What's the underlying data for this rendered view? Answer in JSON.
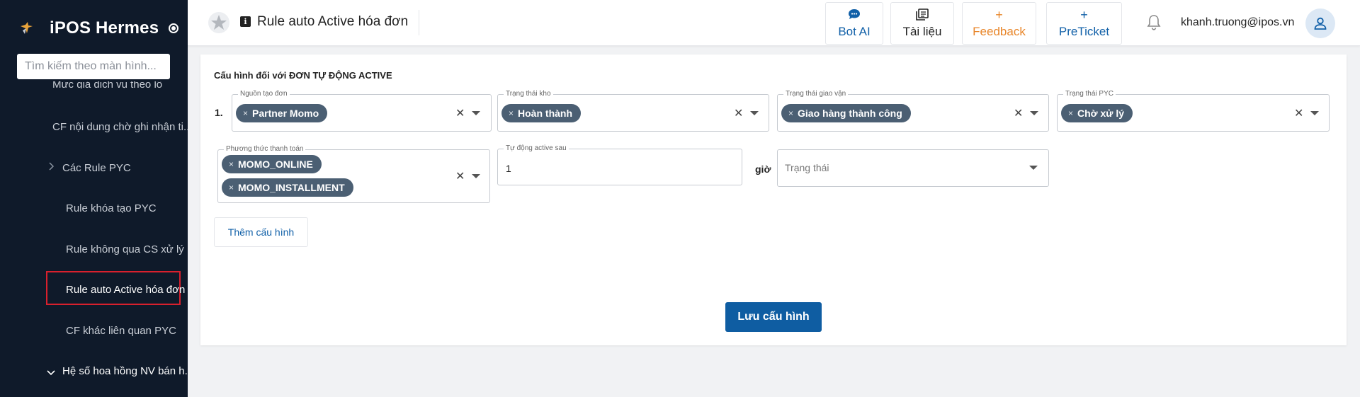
{
  "sidebar": {
    "brand": "iPOS Hermes",
    "search_placeholder": "Tìm kiếm theo màn hình...",
    "items": [
      {
        "label": "CF nội dung chờ ghi nhận ti..."
      },
      {
        "label": "Các Rule PYC"
      },
      {
        "label": "Rule khóa tạo PYC"
      },
      {
        "label": "Rule không qua CS xử lý"
      },
      {
        "label": "Rule auto Active hóa đơn"
      },
      {
        "label": "CF khác liên quan PYC"
      },
      {
        "label": "Hệ số hoa hồng NV bán h..."
      }
    ],
    "partial_item": "Mức giá dịch vụ theo lô"
  },
  "header": {
    "title": "Rule auto Active hóa đơn",
    "buttons": {
      "bot_ai": "Bot AI",
      "tai_lieu": "Tài liệu",
      "feedback": "Feedback",
      "preticket": "PreTicket"
    },
    "user_email": "khanh.truong@ipos.vn"
  },
  "config": {
    "section_title": "Cấu hình đối với ĐƠN TỰ ĐỘNG ACTIVE",
    "row_number": "1.",
    "nguon_tao_don": {
      "label": "Nguồn tạo đơn",
      "chips": [
        "Partner Momo"
      ]
    },
    "trang_thai_kho": {
      "label": "Trạng thái kho",
      "chips": [
        "Hoàn thành"
      ]
    },
    "trang_thai_giao_van": {
      "label": "Trạng thái giao vận",
      "chips": [
        "Giao hàng thành công"
      ]
    },
    "trang_thai_pyc": {
      "label": "Trạng thái PYC",
      "chips": [
        "Chờ xử lý"
      ]
    },
    "phuong_thuc_thanh_toan": {
      "label": "Phương thức thanh toán",
      "chips": [
        "MOMO_ONLINE",
        "MOMO_INSTALLMENT"
      ]
    },
    "tu_dong_active_sau": {
      "label": "Tự động active sau",
      "value": "1"
    },
    "unit": "giờ",
    "trang_thai": {
      "placeholder": "Trạng thái"
    },
    "chip_remove": "×",
    "clear_icon": "✕",
    "add_button": "Thêm cấu hình",
    "save_button": "Lưu cấu hình"
  }
}
